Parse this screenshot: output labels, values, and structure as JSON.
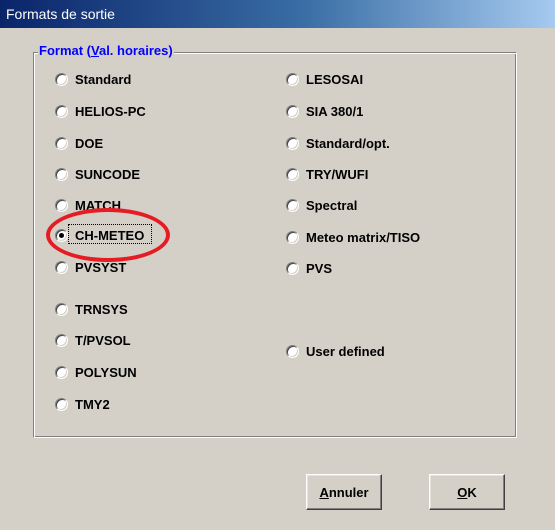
{
  "window": {
    "title": "Formats de sortie"
  },
  "group": {
    "legend_prefix": "Format (",
    "legend_hotkey": "V",
    "legend_suffix": "al. horaires)"
  },
  "options_left": [
    {
      "label": "Standard",
      "checked": false
    },
    {
      "label": "HELIOS-PC",
      "checked": false
    },
    {
      "label": "DOE",
      "checked": false
    },
    {
      "label": "SUNCODE",
      "checked": false
    },
    {
      "label": "MATCH",
      "checked": false
    },
    {
      "label": "CH-METEO",
      "checked": true
    },
    {
      "label": "PVSYST",
      "checked": false
    },
    {
      "label": "TRNSYS",
      "checked": false
    },
    {
      "label": "T/PVSOL",
      "checked": false
    },
    {
      "label": "POLYSUN",
      "checked": false
    },
    {
      "label": "TMY2",
      "checked": false
    }
  ],
  "options_right": [
    {
      "label": "LESOSAI",
      "checked": false
    },
    {
      "label": "SIA 380/1",
      "checked": false
    },
    {
      "label": "Standard/opt.",
      "checked": false
    },
    {
      "label": "TRY/WUFI",
      "checked": false
    },
    {
      "label": "Spectral",
      "checked": false
    },
    {
      "label": "Meteo matrix/TISO",
      "checked": false
    },
    {
      "label": "PVS",
      "checked": false
    },
    {
      "label": "User defined",
      "checked": false
    }
  ],
  "buttons": {
    "cancel_hotkey": "A",
    "cancel_rest": "nnuler",
    "ok_hotkey": "O",
    "ok_rest": "K"
  },
  "colors": {
    "legend": "#0000ff",
    "highlight_ellipse": "#e51c23",
    "dialog_background": "#d4d0c8"
  }
}
